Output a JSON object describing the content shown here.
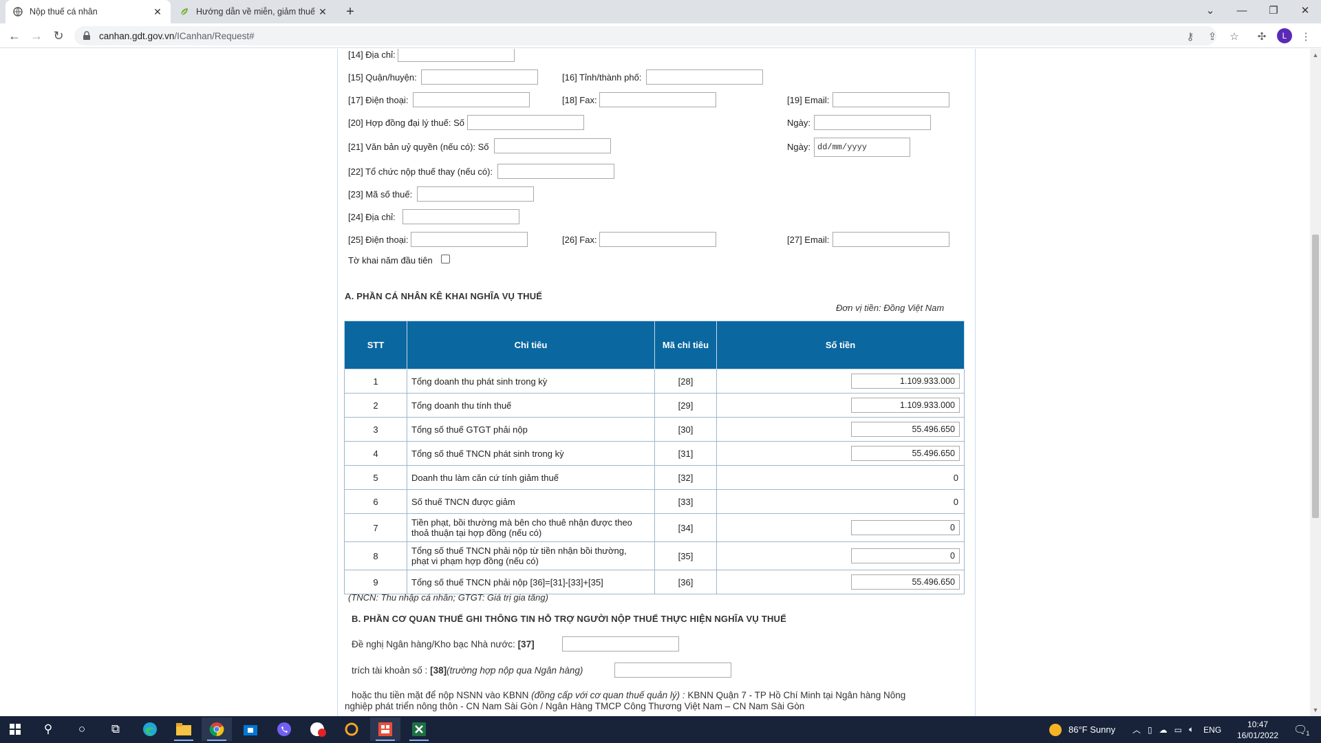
{
  "browser": {
    "tabs": [
      {
        "label": "Nộp thuế cá nhân",
        "icon": "globe-icon",
        "active": true
      },
      {
        "label": "Hướng dẫn về miễn, giảm thuế c",
        "icon": "leaf-icon",
        "active": false
      }
    ],
    "new_tab": "+",
    "url_host": "canhan.gdt.gov.vn",
    "url_path": "/ICanhan/Request#",
    "profile_initial": "L"
  },
  "form": {
    "f14": "[14] Địa chỉ:",
    "f15": "[15] Quận/huyện:",
    "f16": "[16] Tỉnh/thành phố:",
    "f17": "[17] Điện thoại:",
    "f18": "[18] Fax:",
    "f19": "[19] Email:",
    "f20": "[20] Hợp đồng đại lý thuế: Số",
    "f20_date": "Ngày:",
    "f21": "[21] Văn bản uỷ quyền (nếu có): Số",
    "f21_date": "Ngày:",
    "f21_date_placeholder": "dd/mm/yyyy",
    "f22": "[22] Tổ chức nộp thuế thay (nếu có):",
    "f23": "[23] Mã số thuế:",
    "f24": "[24] Địa chỉ:",
    "f25": "[25] Điện thoại:",
    "f26": "[26] Fax:",
    "f27": "[27] Email:",
    "first_year": "Tờ khai năm đầu tiên"
  },
  "section_a": {
    "title": "A. PHẦN CÁ NHÂN KÊ KHAI NGHĨA VỤ THUẾ",
    "currency": "Đơn vị tiền: Đồng Việt Nam",
    "headers": [
      "STT",
      "Chỉ tiêu",
      "Mã chỉ tiêu",
      "Số tiền"
    ],
    "rows": [
      {
        "stt": "1",
        "label": "Tổng doanh thu phát sinh trong kỳ",
        "code": "[28]",
        "amount": "1.109.933.000",
        "input": true
      },
      {
        "stt": "2",
        "label": "Tổng doanh thu tính thuế",
        "code": "[29]",
        "amount": "1.109.933.000",
        "input": true
      },
      {
        "stt": "3",
        "label": "Tổng số thuế GTGT phải nộp",
        "code": "[30]",
        "amount": "55.496.650",
        "input": true
      },
      {
        "stt": "4",
        "label": "Tổng số thuế TNCN phát sinh trong kỳ",
        "code": "[31]",
        "amount": "55.496.650",
        "input": true
      },
      {
        "stt": "5",
        "label": "Doanh thu làm căn cứ tính giảm thuế",
        "code": "[32]",
        "amount": "0",
        "input": false
      },
      {
        "stt": "6",
        "label": "Số thuế TNCN được giảm",
        "code": "[33]",
        "amount": "0",
        "input": false
      },
      {
        "stt": "7",
        "label": "Tiền phạt, bồi thường mà bên cho thuê nhận được theo thoả thuận tại hợp đồng (nếu có)",
        "code": "[34]",
        "amount": "0",
        "input": true
      },
      {
        "stt": "8",
        "label": "Tổng số thuế TNCN phải nộp từ tiền nhận bồi thường, phạt vi phạm hợp đồng (nếu có)",
        "code": "[35]",
        "amount": "0",
        "input": true
      },
      {
        "stt": "9",
        "label": "Tổng số thuế TNCN phải nộp [36]=[31]-[33]+[35]",
        "code": "[36]",
        "amount": "55.496.650",
        "input": true
      }
    ],
    "note": "(TNCN: Thu nhập cá nhân; GTGT: Giá trị gia tăng)"
  },
  "section_b": {
    "title": "B. PHẦN CƠ QUAN THUẾ GHI THÔNG TIN HỖ TRỢ NGƯỜI NỘP THUẾ THỰC HIỆN NGHĨA VỤ THUẾ",
    "bank_label": "Đề nghị Ngân hàng/Kho bạc Nhà nước:",
    "bank_code": "[37]",
    "account_label": "trích tài khoản số :",
    "account_code": "[38]",
    "account_hint": "(trường hợp nộp qua Ngân hàng)",
    "cash_prefix": "hoặc thu tiền mặt để nộp NSNN vào KBNN",
    "cash_hint": "(đồng cấp với cơ quan thuế quản lý) :",
    "cash_line1": "KBNN Quận 7 - TP Hồ Chí Minh tại Ngân hàng Nông",
    "cash_line2": "nghiệp phát triển nông thôn - CN Nam Sài Gòn / Ngân Hàng TMCP Công Thương Việt Nam – CN Nam Sài Gòn"
  },
  "taskbar": {
    "weather": "86°F  Sunny",
    "lang": "ENG",
    "time": "10:47",
    "date": "16/01/2022",
    "notif_count": "1"
  }
}
